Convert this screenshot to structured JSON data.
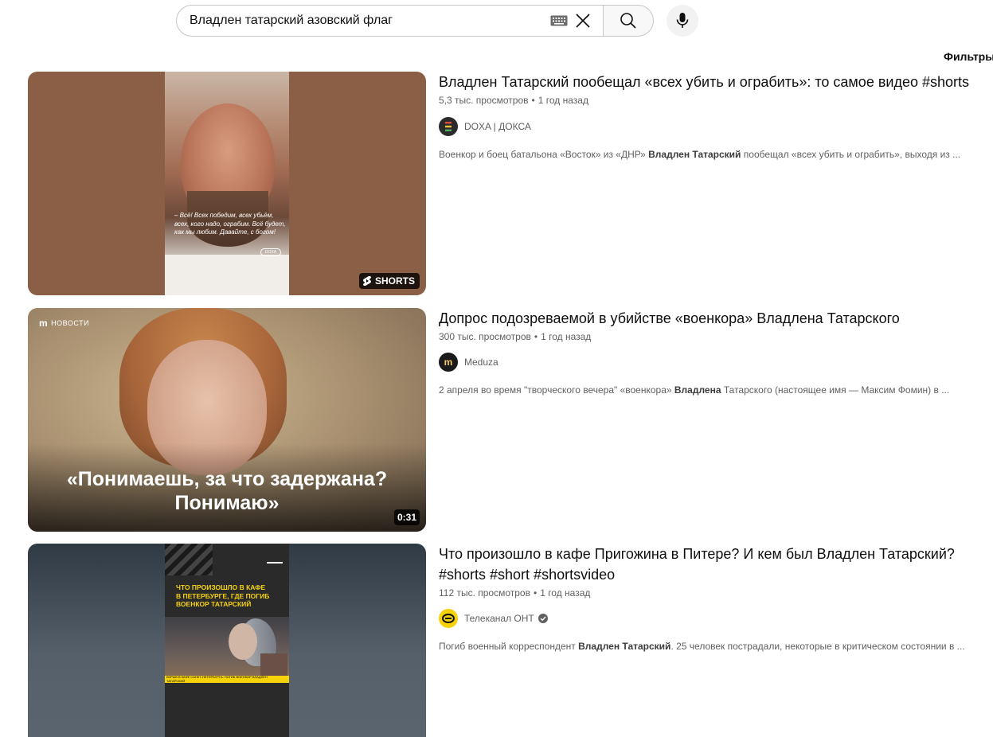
{
  "search": {
    "query": "Владлен татарский азовский флаг"
  },
  "filters_label": "Фильтры",
  "results": [
    {
      "title": "Владлен Татарский пообещал «всех убить и ограбить»: то самое видео #shorts",
      "title_line2": "",
      "views": "5,3 тыс. просмотров",
      "age": "1 год назад",
      "channel": "DOXA | ДОКСА",
      "desc_before": "Военкор и боец батальона «Восток» из «ДНР» ",
      "desc_bold": "Владлен Татарский",
      "desc_after": " пообещал «всех убить и ограбить», выходя из ...",
      "badge": "SHORTS",
      "thumb_caption": "– Всё! Всех победим, всех убьём, всех, кого надо, ограбим. Всё будет, как мы любим. Давайте, с богом!",
      "thumb_mark": "DOXA"
    },
    {
      "title": "Допрос подозреваемой в убийстве «военкора» Владлена Татарского",
      "title_line2": "",
      "views": "300 тыс. просмотров",
      "age": "1 год назад",
      "channel": "Meduza",
      "desc_before": "2 апреля во время \"творческого вечера\" «военкора» ",
      "desc_bold": "Владлена",
      "desc_after": " Татарского (настоящее имя — Максим Фомин) в ...",
      "badge": "0:31",
      "thumb_quote": "«Понимаешь, за что задержана? Понимаю»",
      "thumb_tag": "НОВОСТИ",
      "thumb_tag_logo": "m"
    },
    {
      "title": "Что произошло в кафе Пригожина в Питере? И кем был Владлен Татарский?",
      "title_line2": "#shorts #short #shortsvideo",
      "views": "112 тыс. просмотров",
      "age": "1 год назад",
      "channel": "Телеканал ОНТ",
      "desc_before": "Погиб военный корреспондент ",
      "desc_bold": "Владлен Татарский",
      "desc_after": ". 25 человек пострадали, некоторые в критическом состоянии в ...",
      "thumb_headline": "ЧТО ПРОИЗОШЛО В КАФЕ В ПЕТЕРБУРГЕ, ГДЕ ПОГИБ ВОЕНКОР ТАТАРСКИЙ",
      "thumb_ticker": "ВЗРЫВ В КАФЕ САНКТ-ПЕТЕРБУРГА: ПОГИБ ВОЕНКОР ВЛАДЛЕН ТАТАРСКИЙ"
    }
  ],
  "colors": {
    "text_primary": "#0f0f0f",
    "text_secondary": "#606060",
    "ont_yellow": "#f5d20a"
  },
  "icons": [
    "keyboard-icon",
    "clear-icon",
    "search-icon",
    "microphone-icon",
    "shorts-icon",
    "verified-icon"
  ]
}
